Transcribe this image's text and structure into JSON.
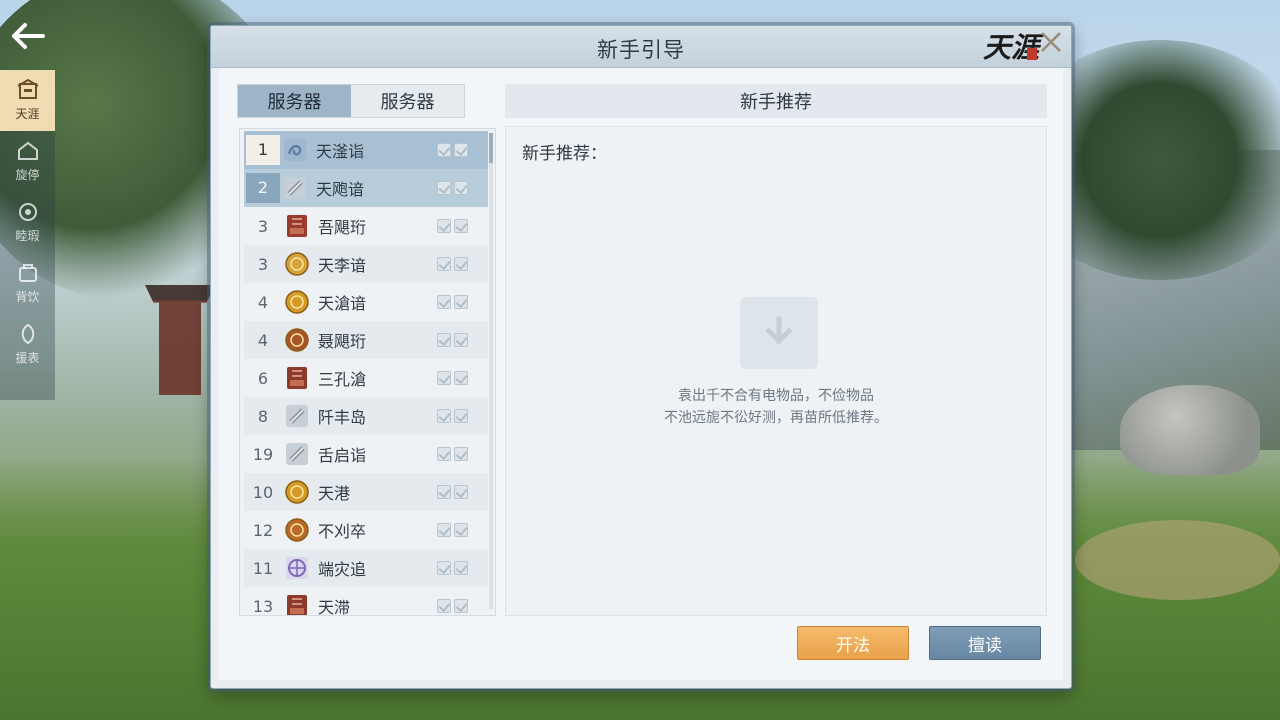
{
  "panel": {
    "title": "新手引导",
    "logo_text": "天涯"
  },
  "nav": {
    "items": [
      {
        "label": "天涯",
        "icon": "house-icon",
        "active": true
      },
      {
        "label": "旋停",
        "icon": "home-icon",
        "active": false
      },
      {
        "label": "睦瑕",
        "icon": "badge-icon",
        "active": false
      },
      {
        "label": "背饮",
        "icon": "bag-icon",
        "active": false
      },
      {
        "label": "援表",
        "icon": "leaf-icon",
        "active": false
      }
    ]
  },
  "tabs": [
    {
      "label": "服务器",
      "active": true
    },
    {
      "label": "服务器",
      "active": false
    }
  ],
  "servers": [
    {
      "num": "1",
      "name": "天滏诣",
      "icon_color": "#5f7fa8",
      "icon": "swirl-icon"
    },
    {
      "num": "2",
      "name": "天飑谙",
      "icon_color": "#8e9aa6",
      "icon": "scroll-icon"
    },
    {
      "num": "3",
      "name": "吾飓珩",
      "icon_color": "#9a3b2f",
      "icon": "book-icon"
    },
    {
      "num": "3",
      "name": "天李谙",
      "icon_color": "#d7a43c",
      "icon": "coin-icon"
    },
    {
      "num": "4",
      "name": "天滄谙",
      "icon_color": "#d49a28",
      "icon": "coin-icon"
    },
    {
      "num": "4",
      "name": "聂飓珩",
      "icon_color": "#a8542a",
      "icon": "coin-icon"
    },
    {
      "num": "6",
      "name": "三孔滄",
      "icon_color": "#8d3a2e",
      "icon": "book-icon"
    },
    {
      "num": "8",
      "name": "阡丰岛",
      "icon_color": "#8e9aa6",
      "icon": "scroll-icon"
    },
    {
      "num": "19",
      "name": "舌启诣",
      "icon_color": "#8e9aa6",
      "icon": "scroll-icon"
    },
    {
      "num": "10",
      "name": "天港",
      "icon_color": "#d49a28",
      "icon": "coin-icon"
    },
    {
      "num": "12",
      "name": "不刈卒",
      "icon_color": "#b86a2a",
      "icon": "coin-icon"
    },
    {
      "num": "11",
      "name": "端灾追",
      "icon_color": "#7d6ab8",
      "icon": "orb-icon"
    },
    {
      "num": "13",
      "name": "天滞",
      "icon_color": "#8d3a2e",
      "icon": "book-icon"
    }
  ],
  "recommend": {
    "header": "新手推荐",
    "label": "新手推荐：",
    "empty_line1": "袁出千不合有电物品，不俭物品",
    "empty_line2": "不池远旎不彸好测，再苗所低推荐。"
  },
  "buttons": {
    "primary": "开法",
    "secondary": "擅读"
  },
  "colors": {
    "accent_orange": "#eaa14a",
    "accent_blue": "#6887a3",
    "panel_bg": "#e9eef2"
  }
}
